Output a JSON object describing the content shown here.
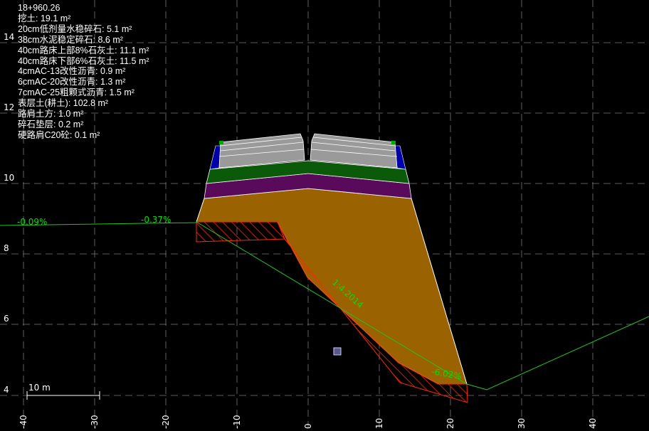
{
  "station": "18+960.26",
  "legend": [
    {
      "label": "挖土: 19.1 m²"
    },
    {
      "label": "20cm低剂量水稳碎石: 5.1 m²"
    },
    {
      "label": "38cm水泥稳定碎石: 8.6 m²"
    },
    {
      "label": "40cm路床上部8%石灰土: 11.1 m²"
    },
    {
      "label": "40cm路床下部6%石灰土: 11.5 m²"
    },
    {
      "label": "4cmAC-13改性沥青: 0.9 m²"
    },
    {
      "label": "6cmAC-20改性沥青: 1.3 m²"
    },
    {
      "label": "7cmAC-25粗颗式沥青: 1.5 m²"
    },
    {
      "label": "表层土(耕土): 102.8 m²"
    },
    {
      "label": "路肩土方: 1.0 m²"
    },
    {
      "label": "碎石垫层: 0.2 m²"
    },
    {
      "label": "硬路肩C20砼: 0.1 m²"
    }
  ],
  "axes": {
    "x_ticks": [
      "-40",
      "-30",
      "-20",
      "-10",
      "0",
      "10",
      "20",
      "30",
      "40"
    ],
    "y_ticks": [
      "14",
      "12",
      "10",
      "8",
      "6",
      "4"
    ]
  },
  "slope_labels": {
    "ground_left_outer": "-0.09%",
    "ground_left_inner": "-0.37%",
    "side_slope": "1:4.2014",
    "ground_right": "-6.02%"
  },
  "scale_bar": {
    "label": "10 m"
  },
  "colors": {
    "background": "#000000",
    "grid": "#7a7a7a",
    "ground_line": "#22c422",
    "fill_earth": "#9a6200",
    "cut_hatch": "#ff2a00",
    "lime_soil": "#5a0a5a",
    "cement_base": "#0a5a0a",
    "asphalt": "#9a9a9a",
    "shoulder": "#0000aa",
    "text": "#ffffff",
    "label": "#00e000"
  }
}
